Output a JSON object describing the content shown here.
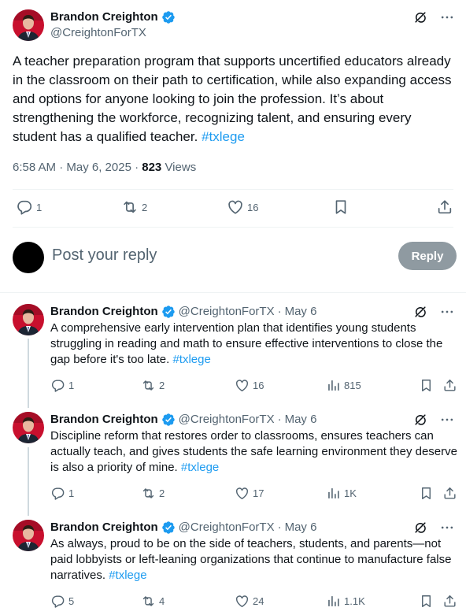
{
  "main": {
    "author_name": "Brandon Creighton",
    "author_handle": "@CreightonForTX",
    "text": "A teacher preparation program that supports uncertified educators already in the classroom on their path to certification, while also expanding access and options for anyone looking to join the profession. It’s about strengthening the workforce, recognizing talent, and ensuring every student has a qualified teacher.",
    "hashtag": "#txlege",
    "time": "6:58 AM · May 6, 2025 · ",
    "views_count": "823",
    "views_label": " Views",
    "stats": {
      "replies": "1",
      "reposts": "2",
      "likes": "16"
    }
  },
  "reply_composer": {
    "placeholder": "Post your reply",
    "button_label": "Reply"
  },
  "thread": [
    {
      "name": "Brandon Creighton",
      "handle": "@CreightonForTX",
      "date": "May 6",
      "text": "A comprehensive early intervention plan that identifies young students struggling in reading and math to ensure effective interventions to close the gap before it's too late.",
      "hashtag": "#txlege",
      "replies": "1",
      "reposts": "2",
      "likes": "16",
      "views": "815"
    },
    {
      "name": "Brandon Creighton",
      "handle": "@CreightonForTX",
      "date": "May 6",
      "text": "Discipline reform that restores order to classrooms, ensures teachers can actually teach, and gives students the safe learning environment they deserve is also a priority of mine.",
      "hashtag": "#txlege",
      "replies": "1",
      "reposts": "2",
      "likes": "17",
      "views": "1K"
    },
    {
      "name": "Brandon Creighton",
      "handle": "@CreightonForTX",
      "date": "May 6",
      "text": "As always, proud to be on the side of teachers, students, and parents—not paid lobbyists or left-leaning organizations that continue to manufacture false narratives.",
      "hashtag": "#txlege",
      "replies": "5",
      "reposts": "4",
      "likes": "24",
      "views": "1.1K"
    }
  ],
  "colors": {
    "accent": "#1d9bf0",
    "verified": "#1d9bf0",
    "muted": "#536471",
    "reply_button": "#8f9aa1"
  }
}
